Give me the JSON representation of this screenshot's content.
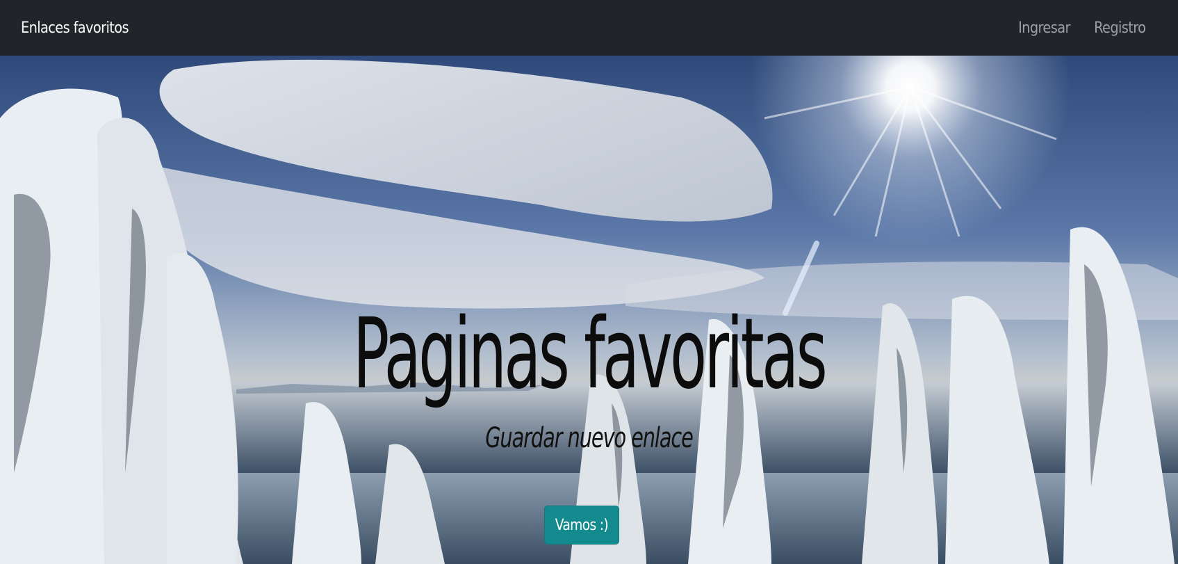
{
  "navbar": {
    "brand": "Enlaces favoritos",
    "links": [
      {
        "label": "Ingresar"
      },
      {
        "label": "Registro"
      }
    ]
  },
  "hero": {
    "title": "Paginas favoritas",
    "subtitle": "Guardar nuevo enlace",
    "button_label": "Vamos :)",
    "colors": {
      "navbar_bg": "#212529",
      "button_bg": "#138a8d",
      "title_text": "#0c0c0c"
    }
  }
}
